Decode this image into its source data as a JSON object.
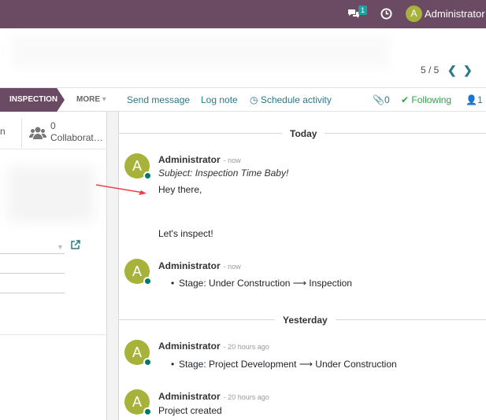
{
  "topbar": {
    "chat_icon": "chat-bubbles-icon",
    "chat_badge": "1",
    "clock_icon": "clock-icon",
    "avatar_letter": "A",
    "username": "Administrator",
    "bg_color": "#6b4a63"
  },
  "pager": {
    "value": "5 / 5",
    "prev": "<",
    "next": ">"
  },
  "statusbar": {
    "active_stage": "INSPECTION",
    "more_label": "MORE",
    "more_caret": "▾"
  },
  "smart_buttons": {
    "partial_label": "n",
    "collaborators_count": "0",
    "collaborators_label": "Collaborat…"
  },
  "chatter": {
    "send_message": "Send message",
    "log_note": "Log note",
    "schedule_activity": "Schedule activity",
    "attachments_count": "0",
    "following": "Following",
    "followers_count": "1",
    "messages": [
      {
        "author": "Administrator",
        "time": "- now",
        "subject": "Subject: Inspection Time Baby!",
        "body_1": "Hey there,",
        "body_2": "Let's inspect!"
      },
      {
        "author": "Administrator",
        "time": "- now",
        "bullet": "Stage: Under Construction ⟶ Inspection"
      },
      {
        "author": "Administrator",
        "time": "- 20 hours ago",
        "bullet": "Stage: Project Development ⟶ Under Construction"
      },
      {
        "author": "Administrator",
        "time": "- 20 hours ago",
        "body_1": "Project created"
      }
    ],
    "separators": {
      "today": "Today",
      "yesterday": "Yesterday"
    },
    "avatar_letter": "A",
    "avatar_color": "#a6b23a",
    "link_color": "#2b7a87",
    "following_color": "#28a745"
  }
}
